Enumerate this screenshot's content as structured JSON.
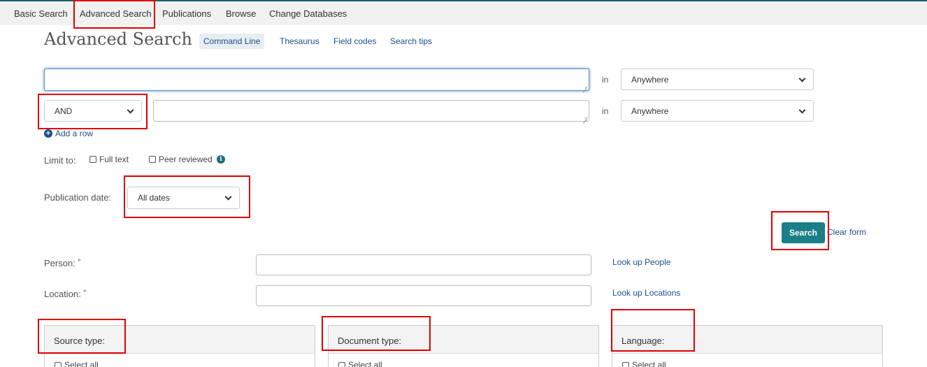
{
  "nav": {
    "basic_search": "Basic Search",
    "advanced_search": "Advanced Search",
    "publications": "Publications",
    "browse": "Browse",
    "change_databases": "Change Databases"
  },
  "header": {
    "title": "Advanced Search",
    "command_line": "Command Line",
    "thesaurus": "Thesaurus",
    "field_codes": "Field codes",
    "search_tips": "Search tips"
  },
  "rows": [
    {
      "value": "",
      "in_label": "in",
      "field": "Anywhere"
    },
    {
      "operator": "AND",
      "value": "",
      "in_label": "in",
      "field": "Anywhere"
    }
  ],
  "add_row": "Add a row",
  "limit": {
    "label": "Limit to:",
    "full_text": "Full text",
    "peer_reviewed": "Peer reviewed"
  },
  "publication_date": {
    "label": "Publication date:",
    "value": "All dates"
  },
  "actions": {
    "search": "Search",
    "clear_form": "Clear form"
  },
  "person": {
    "label": "Person: ˚",
    "lookup": "Look up People"
  },
  "location": {
    "label": "Location: ˚",
    "lookup": "Look up Locations"
  },
  "panels": [
    {
      "title": "Source type:",
      "select_all": "Select all"
    },
    {
      "title": "Document type:",
      "select_all": "Select all"
    },
    {
      "title": "Language:",
      "select_all": "Select all"
    }
  ],
  "colors": {
    "accent": "#1a7f86",
    "link": "#1f4f8b",
    "highlight": "#e00000"
  }
}
